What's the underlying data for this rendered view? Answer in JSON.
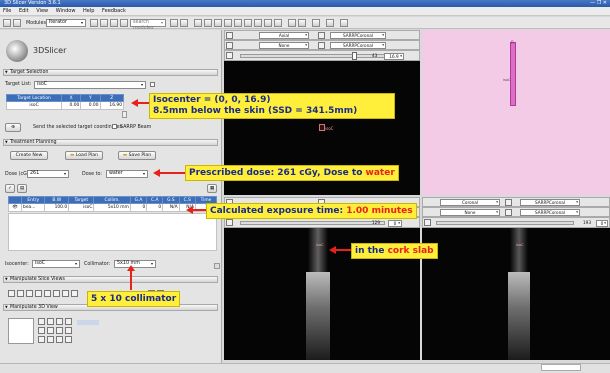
{
  "window": {
    "title": "3D Slicer Version 3.6.1",
    "controls": "— ❐ ✕"
  },
  "menu": [
    "File",
    "Edit",
    "View",
    "Window",
    "Help",
    "Feedback"
  ],
  "toolbar": {
    "modules_label": "Modules:",
    "module_value": "Iterator",
    "search_placeholder": "search modules"
  },
  "app": {
    "logo_text": "3DSlicer"
  },
  "target_selection": {
    "header": "Target Selection",
    "target_list_label": "Target List:",
    "target_list_value": "isoC",
    "columns": [
      "Target Location",
      "X",
      "Y",
      "Z"
    ],
    "row": [
      "isoC",
      "0.00",
      "0.00",
      "16.90"
    ],
    "send_button": "Send the selected target coordinates",
    "sarrp_beam_label": "SARRP Beam"
  },
  "treatment_planning": {
    "header": "Treatment Planning",
    "create_new": "Create New",
    "load_plan": "Load Plan",
    "save_plan": "Save Plan",
    "dose_label": "Dose (cGy):",
    "dose_value": "261",
    "dose_to_label": "Dose to:",
    "dose_to_value": "water",
    "columns": [
      "",
      "Entry",
      "B.W",
      "Target",
      "Collim.",
      "G.A",
      "C.A",
      "G.S",
      "C.S",
      "Time"
    ],
    "row": [
      "",
      "bea...",
      "100.0",
      "isoC",
      "5x10 mm",
      "0",
      "0",
      "N/A",
      "N/A",
      "1.00"
    ],
    "isocenter_label": "Isocenter:",
    "isocenter_value": "isoC",
    "collimator_label": "Collimator:",
    "collimator_value": "5x10 mm"
  },
  "manipulate_slice_header": "Manipulate Slice Views",
  "manipulate_3d_header": "Manipulate 3D View",
  "views": {
    "axial": {
      "orientation": "Axial",
      "fg": "SARRPCoronal",
      "bg_none": "None",
      "bg": "SARRPCoronal",
      "offset": "43",
      "slice": "16.9"
    },
    "coronal": {
      "orientation": "Coronal",
      "fg": "SARRPCoronal",
      "bg_none": "None",
      "bg": "SARRPCoronal",
      "offset": "129",
      "slice": "0"
    },
    "sagittal": {
      "offset": "193",
      "slice": "0"
    },
    "isoc_label": "isoC",
    "r_label": "R"
  },
  "annotations": {
    "isocenter_line1": "Isocenter = (0, 0, 16.9)",
    "isocenter_line2": "8.5mm below the skin (SSD = 341.5mm)",
    "dose_text": "Prescribed dose: 261 cGy, Dose to ",
    "dose_highlight": "water",
    "time_text": "Calculated exposure time: ",
    "time_highlight": "1.00 minutes",
    "cork_text": "in the ",
    "cork_highlight": "cork slab",
    "collimator_text": "5 x 10 collimator"
  },
  "colors": {
    "annotation_bg": "#ffef3a",
    "annotation_text": "#1a2a8a",
    "arrow": "#e8211b",
    "header_blue": "#3d6fb8",
    "view_3d": "#f3cbe6"
  }
}
